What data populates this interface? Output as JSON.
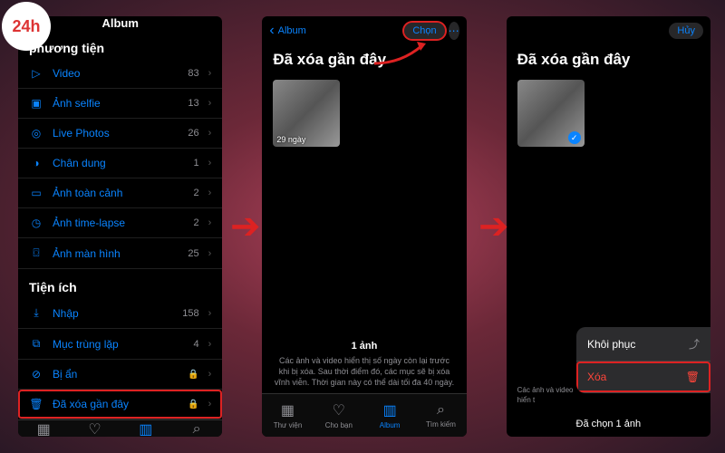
{
  "logo_label": "24h",
  "phone1": {
    "nav_title": "Album",
    "section1": "phương tiện",
    "section2": "Tiện ích",
    "rows": [
      {
        "icon": "▷",
        "label": "Video",
        "count": "83",
        "disc": "›"
      },
      {
        "icon": "▣",
        "label": "Ảnh selfie",
        "count": "13",
        "disc": "›"
      },
      {
        "icon": "◎",
        "label": "Live Photos",
        "count": "26",
        "disc": "›"
      },
      {
        "icon": "◑",
        "label": "Chân dung",
        "count": "1",
        "disc": "›"
      },
      {
        "icon": "▭",
        "label": "Ảnh toàn cảnh",
        "count": "2",
        "disc": "›"
      },
      {
        "icon": "◷",
        "label": "Ảnh time-lapse",
        "count": "2",
        "disc": "›"
      },
      {
        "icon": "⌼",
        "label": "Ảnh màn hình",
        "count": "25",
        "disc": "›"
      }
    ],
    "util_rows": [
      {
        "icon": "⤓",
        "label": "Nhập",
        "count": "158",
        "disc": "›"
      },
      {
        "icon": "⧉",
        "label": "Mục trùng lặp",
        "count": "4",
        "disc": "›"
      },
      {
        "icon": "⊘",
        "label": "Bị ẩn",
        "lock": "🔒",
        "disc": "›"
      },
      {
        "icon": "🗑",
        "label": "Đã xóa gần đây",
        "lock": "🔒",
        "disc": "›"
      }
    ]
  },
  "phone2": {
    "back_label": "Album",
    "select_label": "Chọn",
    "title": "Đã xóa gần đây",
    "thumb_days": "29 ngày",
    "info_title": "1 ảnh",
    "info_text": "Các ảnh và video hiển thị số ngày còn lại trước khi bị xóa. Sau thời điểm đó, các mục sẽ bị xóa vĩnh viễn. Thời gian này có thể dài tối đa 40 ngày."
  },
  "phone3": {
    "cancel_label": "Hủy",
    "title": "Đã xóa gần đây",
    "info_text": "Các ảnh và video hiển t",
    "menu_recover": "Khôi phục",
    "menu_delete": "Xóa",
    "selected_text": "Đã chọn 1 ảnh"
  },
  "tabs": [
    {
      "icon": "▦",
      "label": "Thư viện"
    },
    {
      "icon": "♡",
      "label": "Cho bạn"
    },
    {
      "icon": "▥",
      "label": "Album"
    },
    {
      "icon": "⌕",
      "label": "Tìm kiếm"
    }
  ]
}
